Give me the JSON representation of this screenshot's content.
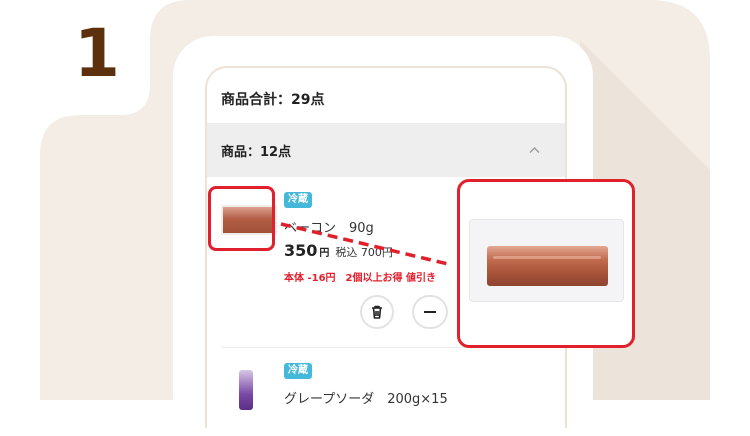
{
  "step": {
    "number": "1"
  },
  "cart": {
    "total_label": "商品合計：29点",
    "section_title": "商品：12点"
  },
  "items": [
    {
      "badge": "冷蔵",
      "name": "ベーコン　90g",
      "price": "350",
      "currency": "円",
      "tax_price": "税込 700円",
      "discount_note": "本体 -16円　2個以上お得 値引き",
      "delete_icon": "trash-icon",
      "minus_icon": "minus-icon"
    },
    {
      "badge": "冷蔵",
      "name": "グレープソーダ　200g×15"
    }
  ],
  "colors": {
    "accent_red": "#e0202c",
    "badge_blue": "#44b8d8",
    "step_brown": "#5c300c",
    "background_beige": "#f3ede6"
  }
}
